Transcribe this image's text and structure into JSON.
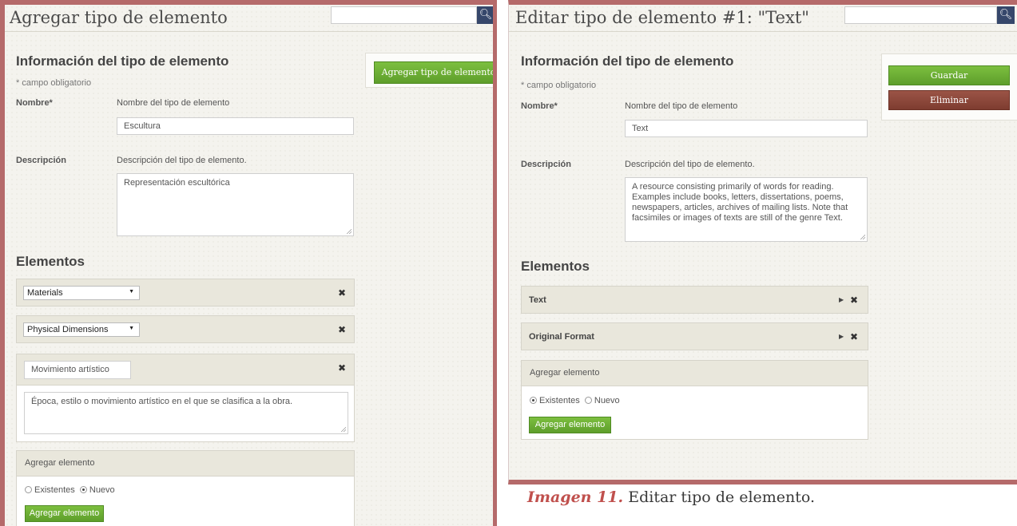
{
  "left": {
    "title": "Agregar tipo de elemento",
    "section_title": "Información del tipo de elemento",
    "required_note": "* campo obligatorio",
    "name_label": "Nombre*",
    "name_help": "Nombre del tipo de elemento",
    "name_value": "Escultura",
    "desc_label": "Descripción",
    "desc_help": "Descripción del tipo de elemento.",
    "desc_value": "Representación escultórica",
    "elements_title": "Elementos",
    "elements": [
      {
        "select": "Materials"
      },
      {
        "select": "Physical Dimensions"
      }
    ],
    "new_element_name": "Movimiento artístico",
    "new_element_desc": "Época, estilo o movimiento artístico en el que se clasifica a la obra.",
    "add_element_header": "Agregar elemento",
    "radio_existing": "Existentes",
    "radio_new": "Nuevo",
    "add_element_button": "Agregar elemento",
    "side_button": "Agregar tipo de elemento"
  },
  "right": {
    "title": "Editar tipo de elemento #1: \"Text\"",
    "section_title": "Información del tipo de elemento",
    "required_note": "* campo obligatorio",
    "name_label": "Nombre*",
    "name_help": "Nombre del tipo de elemento",
    "name_value": "Text",
    "desc_label": "Descripción",
    "desc_help": "Descripción del tipo de elemento.",
    "desc_lines": [
      "A resource consisting primarily of words for reading.",
      "Examples include books, letters, dissertations, poems,",
      "newspapers, articles, archives of mailing lists. Note that",
      "facsimiles or images of texts are still of the genre Text."
    ],
    "elements_title": "Elementos",
    "elements": [
      {
        "name": "Text"
      },
      {
        "name": "Original Format"
      }
    ],
    "add_element_header": "Agregar elemento",
    "radio_existing": "Existentes",
    "radio_new": "Nuevo",
    "add_element_button": "Agregar elemento",
    "save_button": "Guardar",
    "delete_button": "Eliminar"
  },
  "caption": {
    "number": "Imagen 11.",
    "text": " Editar tipo de elemento."
  },
  "colors": {
    "frame": "#b56a6a",
    "green": "#6aaa32",
    "red": "#8b4538",
    "search_button": "#36476b"
  },
  "icons": {
    "search": "search-icon",
    "remove": "close-icon",
    "expand": "caret-right-icon",
    "dropdown": "caret-down-icon"
  }
}
